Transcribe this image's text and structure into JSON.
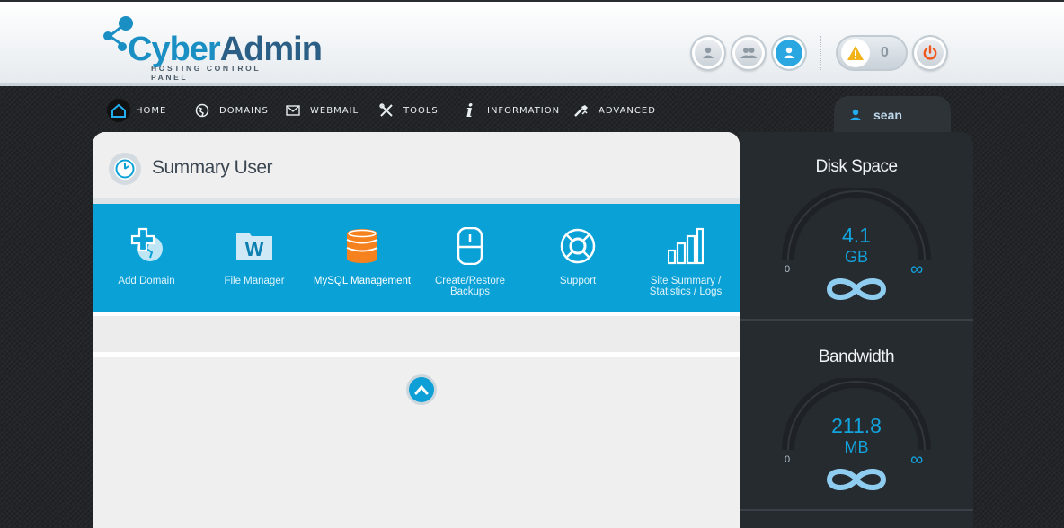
{
  "brand": {
    "name_part1": "Cyber",
    "name_part2": "Admin",
    "tagline": "HOSTING CONTROL PANEL"
  },
  "header": {
    "user_buttons": [
      "single-user-icon",
      "users-icon",
      "user-active-icon"
    ],
    "alerts_count": "0",
    "power_icon": "power-icon"
  },
  "nav": {
    "items": [
      {
        "label": "HOME",
        "icon": "home-icon"
      },
      {
        "label": "DOMAINS",
        "icon": "globe-icon"
      },
      {
        "label": "WEBMAIL",
        "icon": "mail-icon"
      },
      {
        "label": "TOOLS",
        "icon": "tools-icon"
      },
      {
        "label": "INFORMATION",
        "icon": "info-icon"
      },
      {
        "label": "ADVANCED",
        "icon": "wrench-icon"
      }
    ]
  },
  "user": {
    "name": "sean"
  },
  "main": {
    "title": "Summary User",
    "tiles": [
      {
        "label": "Add Domain",
        "icon": "add-domain-icon"
      },
      {
        "label": "File Manager",
        "icon": "file-manager-icon"
      },
      {
        "label": "MySQL Management",
        "icon": "database-icon"
      },
      {
        "label": "Create/Restore Backups",
        "icon": "backup-icon"
      },
      {
        "label": "Support",
        "icon": "support-icon"
      },
      {
        "label": "Site Summary / Statistics / Logs",
        "icon": "statistics-icon"
      }
    ]
  },
  "gauges": [
    {
      "title": "Disk Space",
      "value": "4.1",
      "unit": "GB",
      "min": "0",
      "max": "∞"
    },
    {
      "title": "Bandwidth",
      "value": "211.8",
      "unit": "MB",
      "min": "0",
      "max": "∞"
    }
  ],
  "colors": {
    "accent": "#0aa1d6",
    "brand_dark": "#2c5f86",
    "sidebar_bg": "#262b30",
    "alert": "#f2b21a",
    "power": "#f0571d"
  }
}
